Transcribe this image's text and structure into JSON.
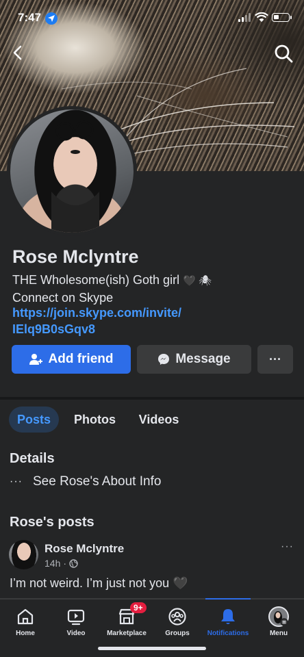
{
  "status_bar": {
    "time": "7:47"
  },
  "profile": {
    "name": "Rose Mclyntre",
    "bio_line1": "THE Wholesome(ish) Goth girl",
    "bio_emoji": "🖤 🕷",
    "bio_line2": "Connect on Skype",
    "link_line1": "https://join.skype.com/invite/",
    "link_line2": "IElq9B0sGqv8"
  },
  "actions": {
    "add_friend": "Add friend",
    "message": "Message",
    "more": "···"
  },
  "tabs": [
    {
      "label": "Posts",
      "active": true
    },
    {
      "label": "Photos",
      "active": false
    },
    {
      "label": "Videos",
      "active": false
    }
  ],
  "details": {
    "title": "Details",
    "dots": "···",
    "about": "See Rose's About Info"
  },
  "posts": {
    "title": "Rose's posts",
    "items": [
      {
        "author": "Rose Mclyntre",
        "time": "14h",
        "dot": "·",
        "more": "···",
        "text": "I’m not weird. I’m just not you 🖤"
      }
    ]
  },
  "bottom_nav": {
    "items": [
      {
        "label": "Home",
        "icon": "home-icon"
      },
      {
        "label": "Video",
        "icon": "video-icon"
      },
      {
        "label": "Marketplace",
        "icon": "marketplace-icon",
        "badge": "9+"
      },
      {
        "label": "Groups",
        "icon": "groups-icon"
      },
      {
        "label": "Notifications",
        "icon": "notifications-icon",
        "active": true
      },
      {
        "label": "Menu",
        "icon": "menu-avatar-icon"
      }
    ]
  },
  "colors": {
    "background": "#242526",
    "accent": "#2d6de8",
    "link": "#4599ff",
    "badge": "#e41e3f"
  }
}
